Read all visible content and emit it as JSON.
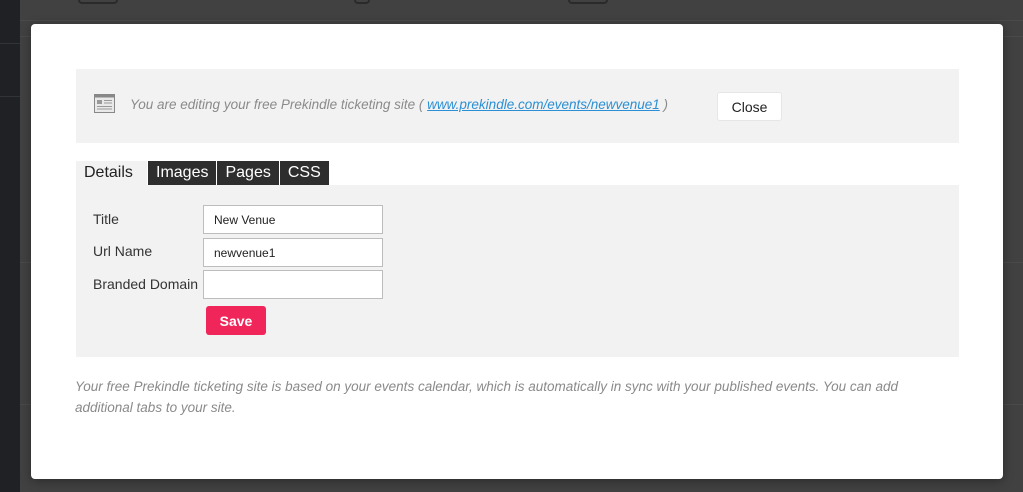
{
  "notice": {
    "prefix": "You are editing your free Prekindle ticketing site ( ",
    "link": "www.prekindle.com/events/newvenue1",
    "suffix": " )",
    "close_label": "Close"
  },
  "tabs": [
    {
      "label": "Details",
      "active": true
    },
    {
      "label": "Images",
      "active": false
    },
    {
      "label": "Pages",
      "active": false
    },
    {
      "label": "CSS",
      "active": false
    }
  ],
  "form": {
    "title_label": "Title",
    "title_value": "New Venue",
    "url_label": "Url Name",
    "url_value": "newvenue1",
    "domain_label": "Branded Domain",
    "domain_value": "",
    "save_label": "Save"
  },
  "footer": {
    "text": "Your free Prekindle ticketing site is based on your events calendar, which is automatically in sync with your published events. You can add additional tabs to your site."
  },
  "colors": {
    "accent": "#f0265b",
    "link": "#2a8fd4",
    "panel": "#f2f2f2",
    "tab_dark": "#2e2e2e"
  }
}
